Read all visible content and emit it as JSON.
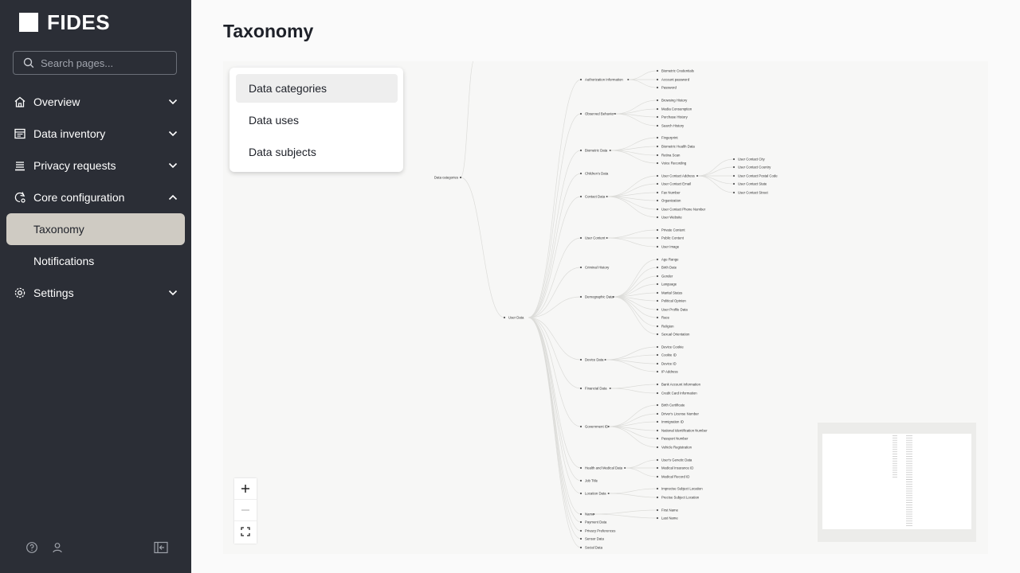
{
  "app": {
    "brand": "FIDES"
  },
  "search": {
    "placeholder": "Search pages..."
  },
  "nav": {
    "overview": "Overview",
    "data_inventory": "Data inventory",
    "privacy_requests": "Privacy requests",
    "core_configuration": "Core configuration",
    "taxonomy": "Taxonomy",
    "notifications": "Notifications",
    "settings": "Settings"
  },
  "page": {
    "title": "Taxonomy"
  },
  "menu": {
    "items": [
      "Data categories",
      "Data uses",
      "Data subjects"
    ]
  },
  "zoom": {
    "in": "+",
    "out": "—",
    "fit": "⛶"
  },
  "tree": {
    "root": "Data categories",
    "user_data": "User Data",
    "groups": [
      {
        "name": "Authorization Information",
        "children": [
          "Biometric Credentials",
          "Account password",
          "Password"
        ]
      },
      {
        "name": "Observed Behavior",
        "children": [
          "Browsing History",
          "Media Consumption",
          "Purchase History",
          "Search History"
        ]
      },
      {
        "name": "Biometric Data",
        "children": [
          "Fingerprint",
          "Biometric Health Data",
          "Retina Scan",
          "Voice Recording"
        ]
      },
      {
        "name": "Children's Data",
        "children": []
      },
      {
        "name": "Contact Data",
        "children": [
          "User Contact Address",
          "User Contact Email",
          "Fax Number",
          "Organization",
          "User Contact Phone Number",
          "User Website"
        ]
      },
      {
        "name": "User Content",
        "children": [
          "Private Content",
          "Public Content",
          "User Image"
        ]
      },
      {
        "name": "Criminal History",
        "children": []
      },
      {
        "name": "Demographic Data",
        "children": [
          "Age Range",
          "Birth Date",
          "Gender",
          "Language",
          "Marital Status",
          "Political Opinion",
          "User Profile Data",
          "Race",
          "Religion",
          "Sexual Orientation"
        ]
      },
      {
        "name": "Device Data",
        "children": [
          "Device Cookie",
          "Cookie ID",
          "Device ID",
          "IP Address"
        ]
      },
      {
        "name": "Financial Data",
        "children": [
          "Bank Account Information",
          "Credit Card Information"
        ]
      },
      {
        "name": "Government ID",
        "children": [
          "Birth Certificate",
          "Driver's License Number",
          "Immigration ID",
          "National Identification Number",
          "Passport Number",
          "Vehicle Registration"
        ]
      },
      {
        "name": "Health and Medical Data",
        "children": [
          "User's Genetic Data",
          "Medical Insurance ID",
          "Medical Record ID"
        ]
      },
      {
        "name": "Job Title",
        "children": []
      },
      {
        "name": "Location Data",
        "children": [
          "Imprecise Subject Location",
          "Precise Subject Location"
        ]
      },
      {
        "name": "Name",
        "children": [
          "First Name",
          "Last Name"
        ]
      },
      {
        "name": "Payment Data",
        "children": []
      },
      {
        "name": "Privacy Preferences",
        "children": []
      },
      {
        "name": "Sensor Data",
        "children": []
      },
      {
        "name": "Social Data",
        "children": []
      }
    ],
    "address_children": [
      "User Contact City",
      "User Contact Country",
      "User Contact Postal Code",
      "User Contact State",
      "User Contact Street"
    ]
  }
}
